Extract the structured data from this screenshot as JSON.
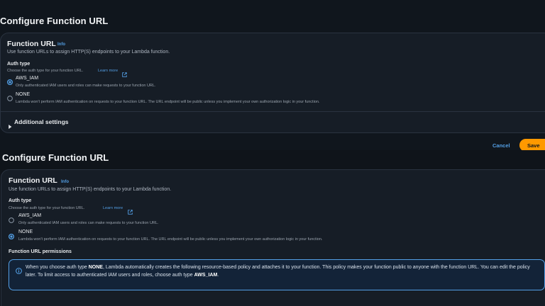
{
  "top_panel": {
    "heading": "Configure Function URL",
    "card_title": "Function URL",
    "info_link": "Info",
    "description": "Use function URLs to assign HTTP(S) endpoints to your Lambda function.",
    "auth_type_label": "Auth type",
    "auth_type_hint": "Choose the auth type for your function URL.",
    "learn_more": "Learn more",
    "options": [
      {
        "label": "AWS_IAM",
        "description": "Only authenticated IAM users and roles can make requests to your function URL.",
        "selected": true
      },
      {
        "label": "NONE",
        "description": "Lambda won't perform IAM authentication on requests to your function URL. The URL endpoint will be public unless you implement your own authorization logic in your function.",
        "selected": false
      }
    ],
    "additional_settings": "Additional settings",
    "cancel_label": "Cancel",
    "save_label": "Save"
  },
  "bottom_panel": {
    "heading": "Configure Function URL",
    "card_title": "Function URL",
    "info_link": "Info",
    "description": "Use function URLs to assign HTTP(S) endpoints to your Lambda function.",
    "auth_type_label": "Auth type",
    "auth_type_hint": "Choose the auth type for your function URL.",
    "learn_more": "Learn more",
    "options": [
      {
        "label": "AWS_IAM",
        "description": "Only authenticated IAM users and roles can make requests to your function URL.",
        "selected": false
      },
      {
        "label": "NONE",
        "description": "Lambda won't perform IAM authentication on requests to your function URL. The URL endpoint will be public unless you implement your own authorization logic in your function.",
        "selected": true
      }
    ],
    "permissions_label": "Function URL permissions",
    "alert": {
      "part1": "When you choose auth type ",
      "bold1": "NONE",
      "part2": ", Lambda automatically creates the following resource-based policy and attaches it to your function. This policy makes your function public to anyone with the function URL. You can edit the policy later. To limit access to authenticated IAM users and roles, choose auth type ",
      "bold2": "AWS_IAM",
      "part3": "."
    }
  },
  "colors": {
    "accent_link": "#539fe5",
    "primary_button": "#ff9900",
    "card_bg": "#161d26",
    "page_bg": "#0f141a"
  }
}
